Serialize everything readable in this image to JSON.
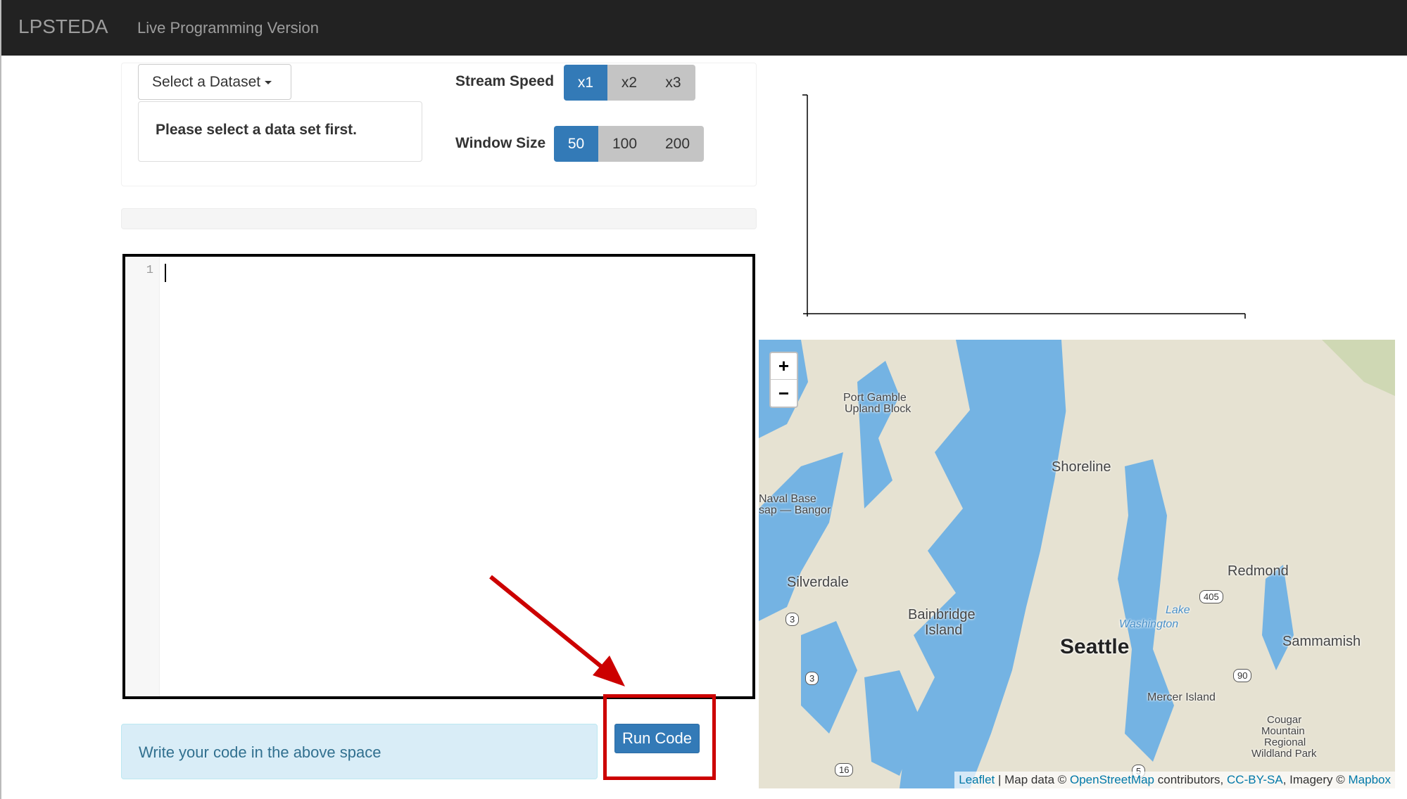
{
  "navbar": {
    "brand": "LPSTEDA",
    "subtitle": "Live Programming Version"
  },
  "controls": {
    "dataset_button": "Select a Dataset",
    "message": "Please select a data set first.",
    "stream_speed": {
      "label": "Stream Speed",
      "options": [
        "x1",
        "x2",
        "x3"
      ],
      "selected": "x1"
    },
    "window_size": {
      "label": "Window Size",
      "options": [
        "50",
        "100",
        "200"
      ],
      "selected": "50"
    }
  },
  "editor": {
    "line_numbers": [
      "1"
    ],
    "content": ""
  },
  "info_text": "Write your code in the above space",
  "run_button": "Run Code",
  "colors": {
    "primary": "#337ab7",
    "highlight": "#cc0000",
    "water": "#74b3e3"
  },
  "map": {
    "zoom_in": "+",
    "zoom_out": "−",
    "labels": [
      "Port Gamble",
      "Upland Block",
      "Shoreline",
      "Naval Base",
      "sap — Bangor",
      "Silverdale",
      "Bainbridge",
      "Island",
      "Seattle",
      "Redmond",
      "Lake",
      "Washington",
      "Sammamish",
      "Mercer Island",
      "Cougar",
      "Mountain",
      "Regional",
      "Wildland Park"
    ],
    "shields": [
      "3",
      "3",
      "16",
      "405",
      "90",
      "5"
    ],
    "attribution": {
      "leaflet": "Leaflet",
      "sep": " | Map data © ",
      "osm": "OpenStreetMap",
      "contrib": " contributors, ",
      "license": "CC-BY-SA",
      "imagery": ", Imagery © ",
      "mapbox": "Mapbox"
    }
  }
}
